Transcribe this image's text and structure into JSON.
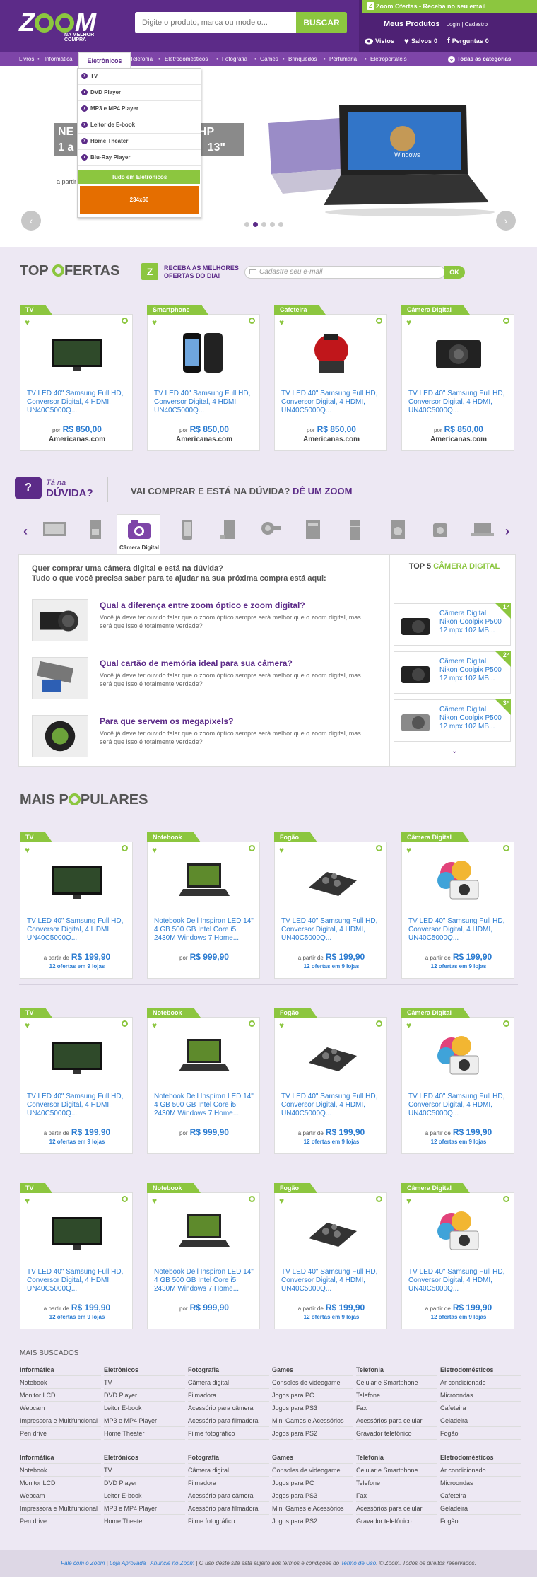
{
  "header": {
    "logo": "Z",
    "logo_rest": "M",
    "tagline": "NA MELHOR COMPRA",
    "search_placeholder": "Digite o produto, marca ou modelo...",
    "search_button": "BUSCAR",
    "promo": "Zoom Ofertas - Receba no seu email",
    "promo_icon": "Z",
    "my_products": "Meus Produtos",
    "login": "Login",
    "sep": "|",
    "signup": "Cadastro",
    "viewed": "Vistos",
    "saved": "Salvos",
    "saved_count": "0",
    "questions": "Perguntas",
    "questions_count": "0"
  },
  "nav": {
    "items": [
      "Livros",
      "Informática",
      "Eletrônicos",
      "Telefonia",
      "Eletrodomésticos",
      "Fotografia",
      "Games",
      "Brinquedos",
      "Perfumaria",
      "Eletroportáteis"
    ],
    "bullet": "•",
    "all": "Todas as categorias"
  },
  "dropdown": {
    "tab": "Eletrônicos",
    "items": [
      "TV",
      "DVD Player",
      "MP3 e MP4 Player",
      "Leitor de E-book",
      "Home Theater",
      "Blu-Ray Player"
    ],
    "all": "Tudo em Eletrônicos",
    "ad": "234x60"
  },
  "hero": {
    "line1": "NE",
    "line1b": "KS HP",
    "line2": "1 a 4",
    "line2b": "13\"",
    "prefix": "a partir",
    "screen_label": "Windows"
  },
  "top_ofertas": {
    "title_a": "TOP ",
    "title_b": "FERTAS",
    "news_icon": "Z",
    "news_line1": "RECEBA AS MELHORES",
    "news_line2": "OFERTAS DO DIA!",
    "email_placeholder": "Cadastre seu e-mail",
    "ok": "OK",
    "cards": [
      {
        "cat": "TV",
        "name": "TV LED 40\" Samsung Full HD, Conversor Digital, 4 HDMI, UN40C5000Q...",
        "por": "por",
        "price": "R$ 850,00",
        "store": "Americanas.com"
      },
      {
        "cat": "Smartphone",
        "name": "TV LED 40\" Samsung Full HD, Conversor Digital, 4 HDMI, UN40C5000Q...",
        "por": "por",
        "price": "R$ 850,00",
        "store": "Americanas.com"
      },
      {
        "cat": "Cafeteira",
        "name": "TV LED 40\" Samsung Full HD, Conversor Digital, 4 HDMI, UN40C5000Q...",
        "por": "por",
        "price": "R$ 850,00",
        "store": "Americanas.com"
      },
      {
        "cat": "Câmera Digital",
        "name": "TV LED 40\" Samsung Full HD, Conversor Digital, 4 HDMI, UN40C5000Q...",
        "por": "por",
        "price": "R$ 850,00",
        "store": "Americanas.com"
      }
    ]
  },
  "duvida": {
    "icon": "?",
    "ta_na": "Tá na",
    "duvida": "DÚVIDA?",
    "question_a": "VAI COMPRAR E ESTÁ NA DÚVIDA? ",
    "question_b": "DÊ UM ZOOM",
    "left_arrow": "‹",
    "right_arrow": "›",
    "selected_category": "Câmera Digital",
    "intro_1": "Quer comprar uma câmera digital e está na dúvida?",
    "intro_2": "Tudo o que você precisa saber para te ajudar na sua próxima compra está aqui:",
    "articles": [
      {
        "title": "Qual a diferença entre zoom óptico e zoom digital?",
        "text": "Você já deve ter ouvido falar que o zoom óptico sempre será melhor que o zoom digital, mas será que isso é totalmente verdade?"
      },
      {
        "title": "Qual cartão de memória ideal para sua câmera?",
        "text": "Você já deve ter ouvido falar que o zoom óptico sempre será melhor que o zoom digital, mas será que isso é totalmente verdade?"
      },
      {
        "title": "Para que servem os megapixels?",
        "text": "Você já deve ter ouvido falar que o zoom óptico sempre será melhor que o zoom digital, mas será que isso é totalmente verdade?"
      }
    ],
    "top5_a": "TOP 5 ",
    "top5_b": "CÂMERA DIGITAL",
    "top5": [
      {
        "rank": "1º",
        "name": "Câmera Digital Nikon Coolpix P500 12 mpx 102 MB..."
      },
      {
        "rank": "2º",
        "name": "Câmera Digital Nikon Coolpix P500 12 mpx 102 MB..."
      },
      {
        "rank": "3º",
        "name": "Câmera Digital Nikon Coolpix P500 12 mpx 102 MB..."
      }
    ],
    "down": "⌄"
  },
  "mais_populares": {
    "title_a": "MAIS P",
    "title_b": "PULARES",
    "rows": [
      [
        {
          "cat": "TV",
          "name": "TV LED 40\" Samsung Full HD, Conversor Digital, 4 HDMI, UN40C5000Q...",
          "apartir": "a partir de",
          "price": "R$ 199,90",
          "offers": "12 ofertas em 9 lojas"
        },
        {
          "cat": "Notebook",
          "name": "Notebook Dell Inspiron LED 14\" 4 GB 500 GB Intel Core i5 2430M Windows 7 Home...",
          "apartir": "por",
          "price": "R$ 999,90",
          "offers": ""
        },
        {
          "cat": "Fogão",
          "name": "TV LED 40\" Samsung Full HD, Conversor Digital, 4 HDMI, UN40C5000Q...",
          "apartir": "a partir de",
          "price": "R$ 199,90",
          "offers": "12 ofertas em 9 lojas"
        },
        {
          "cat": "Câmera Digital",
          "name": "TV LED 40\" Samsung Full HD, Conversor Digital, 4 HDMI, UN40C5000Q...",
          "apartir": "a partir de",
          "price": "R$ 199,90",
          "offers": "12 ofertas em 9 lojas"
        }
      ],
      [
        {
          "cat": "TV",
          "name": "TV LED 40\" Samsung Full HD, Conversor Digital, 4 HDMI, UN40C5000Q...",
          "apartir": "a partir de",
          "price": "R$ 199,90",
          "offers": "12 ofertas em 9 lojas"
        },
        {
          "cat": "Notebook",
          "name": "Notebook Dell Inspiron LED 14\" 4 GB 500 GB Intel Core i5 2430M Windows 7 Home...",
          "apartir": "por",
          "price": "R$ 999,90",
          "offers": ""
        },
        {
          "cat": "Fogão",
          "name": "TV LED 40\" Samsung Full HD, Conversor Digital, 4 HDMI, UN40C5000Q...",
          "apartir": "a partir de",
          "price": "R$ 199,90",
          "offers": "12 ofertas em 9 lojas"
        },
        {
          "cat": "Câmera Digital",
          "name": "TV LED 40\" Samsung Full HD, Conversor Digital, 4 HDMI, UN40C5000Q...",
          "apartir": "a partir de",
          "price": "R$ 199,90",
          "offers": "12 ofertas em 9 lojas"
        }
      ],
      [
        {
          "cat": "TV",
          "name": "TV LED 40\" Samsung Full HD, Conversor Digital, 4 HDMI, UN40C5000Q...",
          "apartir": "a partir de",
          "price": "R$ 199,90",
          "offers": "12 ofertas em 9 lojas"
        },
        {
          "cat": "Notebook",
          "name": "Notebook Dell Inspiron LED 14\" 4 GB 500 GB Intel Core i5 2430M Windows 7 Home...",
          "apartir": "por",
          "price": "R$ 999,90",
          "offers": ""
        },
        {
          "cat": "Fogão",
          "name": "TV LED 40\" Samsung Full HD, Conversor Digital, 4 HDMI, UN40C5000Q...",
          "apartir": "a partir de",
          "price": "R$ 199,90",
          "offers": "12 ofertas em 9 lojas"
        },
        {
          "cat": "Câmera Digital",
          "name": "TV LED 40\" Samsung Full HD, Conversor Digital, 4 HDMI, UN40C5000Q...",
          "apartir": "a partir de",
          "price": "R$ 199,90",
          "offers": "12 ofertas em 9 lojas"
        }
      ]
    ]
  },
  "mais_buscados": {
    "title": "MAIS BUSCADOS",
    "groups": [
      [
        {
          "head": "Informática",
          "items": [
            "Notebook",
            "Monitor LCD",
            "Webcam",
            "Impressora e Multifuncional",
            "Pen drive"
          ]
        },
        {
          "head": "Eletrônicos",
          "items": [
            "TV",
            "DVD Player",
            "Leitor E-book",
            "MP3 e MP4 Player",
            "Home Theater"
          ]
        },
        {
          "head": "Fotografia",
          "items": [
            "Câmera digital",
            "Filmadora",
            "Acessório para câmera",
            "Acessório para filmadora",
            "Filme fotográfico"
          ]
        },
        {
          "head": "Games",
          "items": [
            "Consoles de videogame",
            "Jogos para PC",
            "Jogos para PS3",
            "Mini Games e Acessórios",
            "Jogos para PS2"
          ]
        },
        {
          "head": "Telefonia",
          "items": [
            "Celular e Smartphone",
            "Telefone",
            "Fax",
            "Acessórios para celular",
            "Gravador telefônico"
          ]
        },
        {
          "head": "Eletrodomésticos",
          "items": [
            "Ar condicionado",
            "Microondas",
            "Cafeteira",
            "Geladeira",
            "Fogão"
          ]
        }
      ],
      [
        {
          "head": "Informática",
          "items": [
            "Notebook",
            "Monitor LCD",
            "Webcam",
            "Impressora e Multifuncional",
            "Pen drive"
          ]
        },
        {
          "head": "Eletrônicos",
          "items": [
            "TV",
            "DVD Player",
            "Leitor E-book",
            "MP3 e MP4 Player",
            "Home Theater"
          ]
        },
        {
          "head": "Fotografia",
          "items": [
            "Câmera digital",
            "Filmadora",
            "Acessório para câmera",
            "Acessório para filmadora",
            "Filme fotográfico"
          ]
        },
        {
          "head": "Games",
          "items": [
            "Consoles de videogame",
            "Jogos para PC",
            "Jogos para PS3",
            "Mini Games e Acessórios",
            "Jogos para PS2"
          ]
        },
        {
          "head": "Telefonia",
          "items": [
            "Celular e Smartphone",
            "Telefone",
            "Fax",
            "Acessórios para celular",
            "Gravador telefônico"
          ]
        },
        {
          "head": "Eletrodomésticos",
          "items": [
            "Ar condicionado",
            "Microondas",
            "Cafeteira",
            "Geladeira",
            "Fogão"
          ]
        }
      ]
    ]
  },
  "footer": {
    "links": [
      "Fale com o Zoom",
      "Loja Aprovada",
      "Anuncie no Zoom"
    ],
    "sep": "|",
    "terms_a": "O uso deste site está sujeito aos termos e condições do ",
    "terms_link": "Termo de Uso",
    "terms_b": ". © Zoom. Todos os direitos reservados."
  },
  "colors": {
    "purple": "#5c2b88",
    "green": "#8cc63f",
    "blue": "#2a7bd1"
  },
  "icons": [
    "heart-icon",
    "magnifier-icon",
    "eye-icon",
    "chevron-left-icon",
    "chevron-right-icon",
    "question-icon"
  ]
}
